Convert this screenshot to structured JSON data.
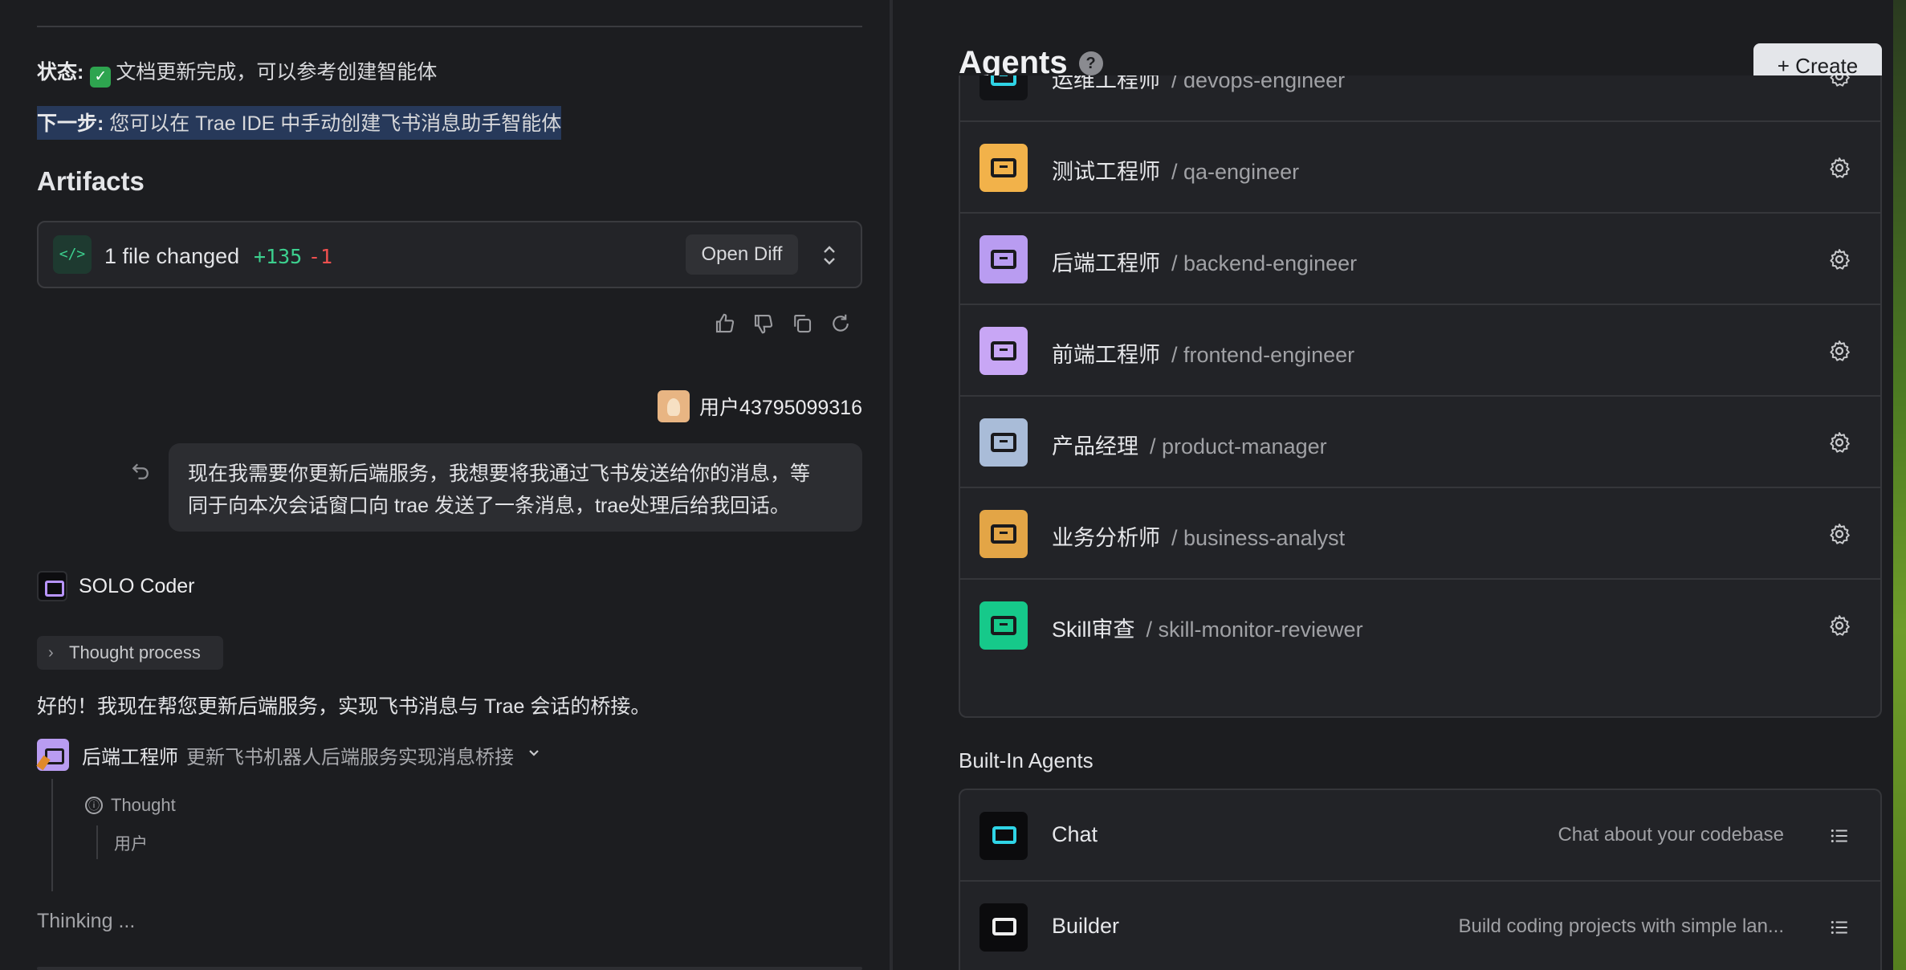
{
  "chat": {
    "status_label": "状态:",
    "status_check": "✓",
    "status_text": "文档更新完成，可以参考创建智能体",
    "next_label": "下一步:",
    "next_text": " 您可以在 Trae IDE 中手动创建飞书消息助手智能体",
    "artifacts_heading": "Artifacts",
    "artifact": {
      "icon_glyph": "</>",
      "files_changed": "1 file changed",
      "additions": "+135",
      "deletions": "-1",
      "open_diff_label": "Open Diff"
    },
    "user": {
      "name": "用户43795099316",
      "message_line1": "现在我需要你更新后端服务，我想要将我通过飞书发送给你的消息，等",
      "message_line2": "同于向本次会话窗口向 trae 发送了一条消息，trae处理后给我回话。"
    },
    "assistant": {
      "name": "SOLO Coder",
      "thought_process_label": "Thought process",
      "reply": "好的！我现在帮您更新后端服务，实现飞书消息与 Trae 会话的桥接。",
      "task_agent": "后端工程师",
      "task_desc": "更新飞书机器人后端服务实现消息桥接",
      "thought_label": "Thought",
      "thought_content": "用户",
      "thinking_label": "Thinking ..."
    }
  },
  "agents": {
    "title": "Agents",
    "help_glyph": "?",
    "create_label": "+  Create",
    "custom": [
      {
        "name": "运维工程师",
        "slug": "/ devops-engineer",
        "bg": "#121316",
        "accent": "#2fd4e6"
      },
      {
        "name": "测试工程师",
        "slug": "/ qa-engineer",
        "bg": "#f2b24a",
        "accent": "#1a1a1d"
      },
      {
        "name": "后端工程师",
        "slug": "/ backend-engineer",
        "bg": "#b99cf1",
        "accent": "#1a1a1d"
      },
      {
        "name": "前端工程师",
        "slug": "/ frontend-engineer",
        "bg": "#c8a6f5",
        "accent": "#1a1a1d"
      },
      {
        "name": "产品经理",
        "slug": "/ product-manager",
        "bg": "#a9bcd8",
        "accent": "#1a1a1d"
      },
      {
        "name": "业务分析师",
        "slug": "/ business-analyst",
        "bg": "#e3a546",
        "accent": "#1a1a1d"
      },
      {
        "name": "Skill审查",
        "slug": "/ skill-monitor-reviewer",
        "bg": "#16c98a",
        "accent": "#1a1a1d"
      }
    ],
    "builtin_heading": "Built-In Agents",
    "builtin": [
      {
        "name": "Chat",
        "desc": "Chat about your codebase",
        "accent": "#2fd4e6"
      },
      {
        "name": "Builder",
        "desc": "Build coding projects with simple lan...",
        "accent": "#eeeeee"
      }
    ]
  }
}
